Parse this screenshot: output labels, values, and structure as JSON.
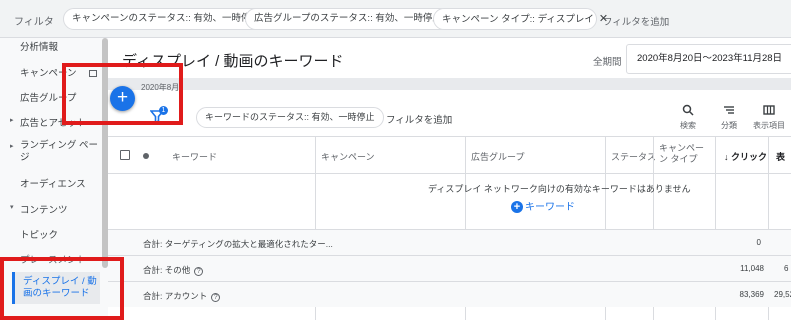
{
  "filter_bar": {
    "label": "フィルタ",
    "chips": [
      "キャンペーンのステータス:: 有効、一時停止",
      "広告グループのステータス:: 有効、一時停止",
      "キャンペーン タイプ:: ディスプレイ"
    ],
    "add_filter": "フィルタを追加"
  },
  "sidebar": {
    "items": [
      {
        "label": "分析情報"
      },
      {
        "label": "キャンペーン"
      },
      {
        "label": "広告グループ"
      },
      {
        "label": "広告とアセット"
      },
      {
        "label": "ランディング ページ"
      },
      {
        "label": "オーディエンス"
      },
      {
        "label": "コンテンツ"
      },
      {
        "label": "トピック"
      },
      {
        "label": "プレースメント"
      },
      {
        "label": "ディスプレイ / 動画のキーワード"
      }
    ]
  },
  "main": {
    "title": "ディスプレイ / 動画のキーワード",
    "period_label": "全期間",
    "period_value": "2020年8月20日～2023年11月28日",
    "date_sub": "2020年8月",
    "fab_label": "+",
    "funnel_badge": "1",
    "keyword_chip": "キーワードのステータス:: 有効、一時停止",
    "keyword_add_filter": "フィルタを追加",
    "tools": [
      {
        "icon": "search-icon",
        "label": "検索"
      },
      {
        "icon": "segment-icon",
        "label": "分類"
      },
      {
        "icon": "columns-icon",
        "label": "表示項目"
      }
    ]
  },
  "table": {
    "headers": [
      "キーワード",
      "キャンペーン",
      "広告グループ",
      "ステータス",
      "キャンペーン タイプ",
      "↓ クリック",
      "表"
    ],
    "empty_message": "ディスプレイ ネットワーク向けの有効なキーワードはありません",
    "add_keyword": "キーワード",
    "rows": [
      {
        "label": "合計: ターゲティングの拡大と最適化されたター...",
        "help": false,
        "clicks": "0",
        "extra": ""
      },
      {
        "label": "合計: その他",
        "help": true,
        "clicks": "11,048",
        "extra": "6"
      },
      {
        "label": "合計: アカウント",
        "help": true,
        "clicks": "83,369",
        "extra": "29,52"
      }
    ]
  }
}
